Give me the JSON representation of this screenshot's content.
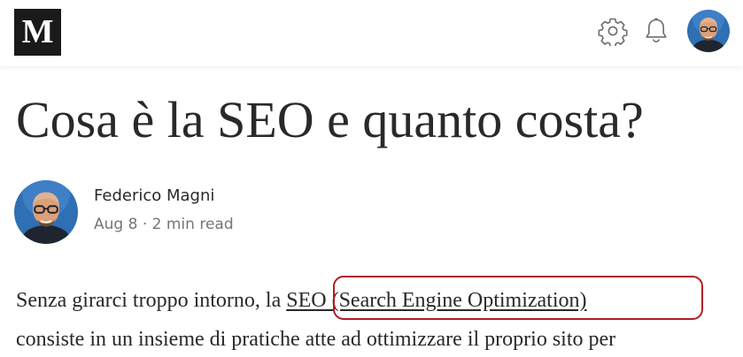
{
  "header": {
    "logo_text": "M",
    "icons": [
      "gear-icon",
      "bell-icon"
    ],
    "avatar": "user-avatar"
  },
  "article": {
    "title": "Cosa è la SEO e quanto costa?",
    "author": {
      "name": "Federico Magni",
      "date": "Aug 8",
      "separator": "·",
      "read_time": "2 min read"
    },
    "paragraph": {
      "before_link": "Senza girarci troppo intorno, la ",
      "link_text": "SEO (Search Engine Optimization)",
      "line2": "consiste in un insieme di pratiche atte ad ottimizzare il proprio sito per"
    }
  },
  "colors": {
    "text": "#292929",
    "meta": "#757575",
    "logo_bg": "#1a1a1a",
    "highlight": "#b01e24"
  }
}
